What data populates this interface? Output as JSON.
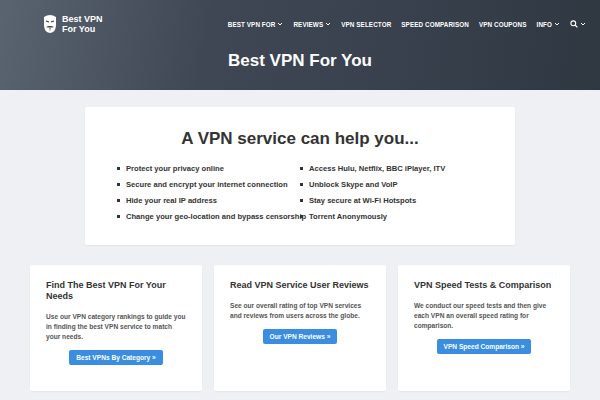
{
  "logo": {
    "line1": "Best VPN",
    "line2": "For You"
  },
  "nav": [
    {
      "label": "BEST VPN FOR",
      "dropdown": true
    },
    {
      "label": "REVIEWS",
      "dropdown": true
    },
    {
      "label": "VPN SELECTOR",
      "dropdown": false
    },
    {
      "label": "SPEED COMPARISON",
      "dropdown": false
    },
    {
      "label": "VPN COUPONS",
      "dropdown": false
    },
    {
      "label": "INFO",
      "dropdown": true
    }
  ],
  "search": {
    "dropdown": true
  },
  "hero": {
    "title": "Best VPN For You"
  },
  "benefits": {
    "title": "A VPN service can help you...",
    "left": [
      "Protect your privacy online",
      "Secure and encrypt your internet connection",
      "Hide your real IP address",
      "Change your geo-location and bypass censorship"
    ],
    "right": [
      "Access Hulu, Netflix, BBC iPlayer, ITV",
      "Unblock Skype and VoIP",
      "Stay secure at Wi-Fi Hotspots",
      "Torrent Anonymously"
    ]
  },
  "cards": [
    {
      "title": "Find The Best VPN For Your Needs",
      "text": "Use our VPN category rankings to guide you in finding the best VPN service to match your needs.",
      "button": "Best VPNs By Category »"
    },
    {
      "title": "Read VPN Service User Reviews",
      "text": "See our overall rating of top VPN services and reviews from users across the globe.",
      "button": "Our VPN Reviews »"
    },
    {
      "title": "VPN Speed Tests & Comparison",
      "text": "We conduct our speed tests and then give each VPN an overall speed rating for comparison.",
      "button": "VPN Speed Comparison »"
    }
  ]
}
